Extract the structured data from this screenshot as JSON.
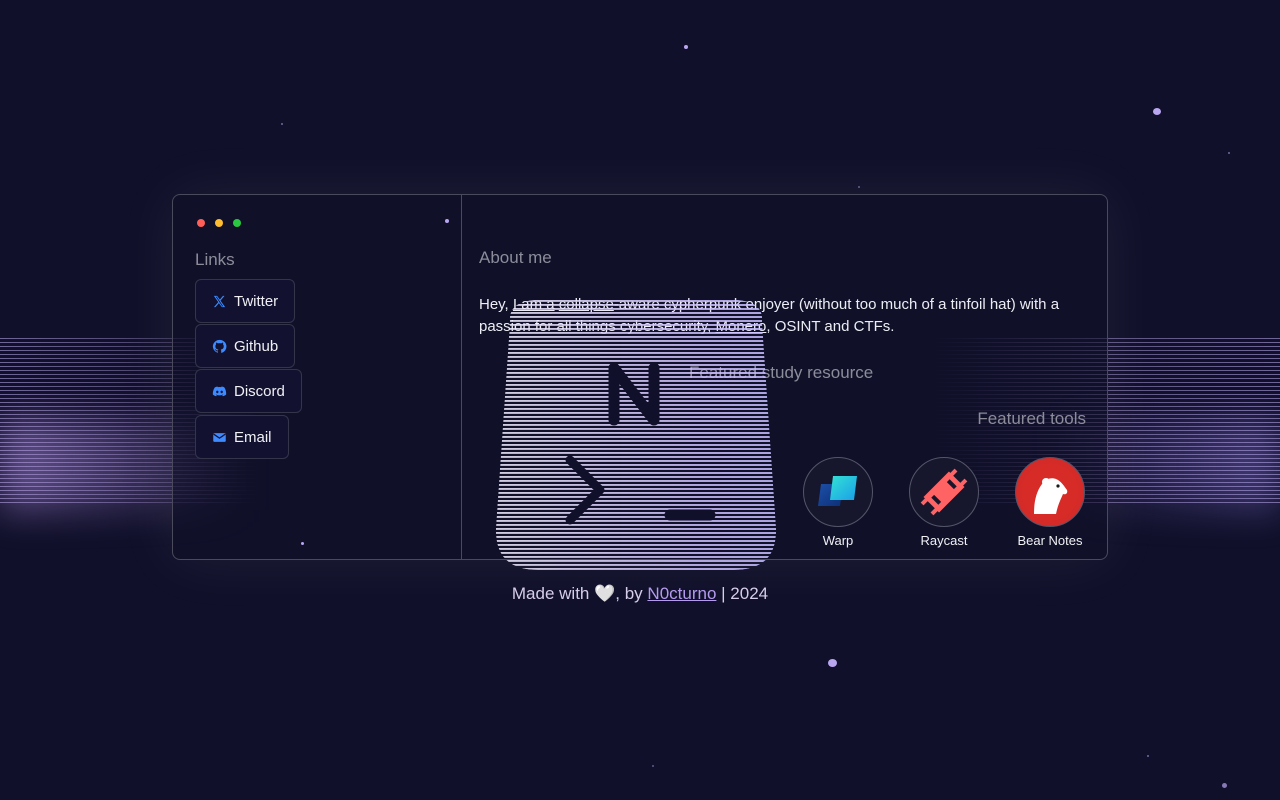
{
  "window": {
    "links_title": "Links",
    "links": [
      {
        "label": "Twitter",
        "icon": "x-twitter-icon"
      },
      {
        "label": "Github",
        "icon": "github-icon"
      },
      {
        "label": "Discord",
        "icon": "discord-icon"
      },
      {
        "label": "Email",
        "icon": "mail-icon"
      }
    ],
    "about": {
      "title": "About me",
      "text_1": "Hey, ",
      "link_1": "I am a",
      "text_2": " ",
      "link_2": "collapse",
      "text_3": "-aware cypherpunk enjoyer (without too much of a tinfoil hat) with a passion for all things cybersecurity, ",
      "link_3": "Monero",
      "text_4": ", OSINT and CTFs."
    },
    "study_title": "Featured study resource",
    "tools_title": "Featured tools",
    "tools": [
      {
        "name": "Warp",
        "icon": "warp-icon"
      },
      {
        "name": "Raycast",
        "icon": "raycast-icon"
      },
      {
        "name": "Bear Notes",
        "icon": "bear-notes-icon"
      }
    ]
  },
  "overlay": {
    "logo_letter": "N"
  },
  "footer": {
    "prefix": "Made with",
    "heart": "🤍",
    "middle": ", by",
    "author": "N0cturno",
    "suffix": "| 2024"
  },
  "colors": {
    "background": "#10102a",
    "accent": "#b49aee",
    "traffic_red": "#ff5f57",
    "traffic_yellow": "#febc2e",
    "traffic_green": "#28c840"
  }
}
